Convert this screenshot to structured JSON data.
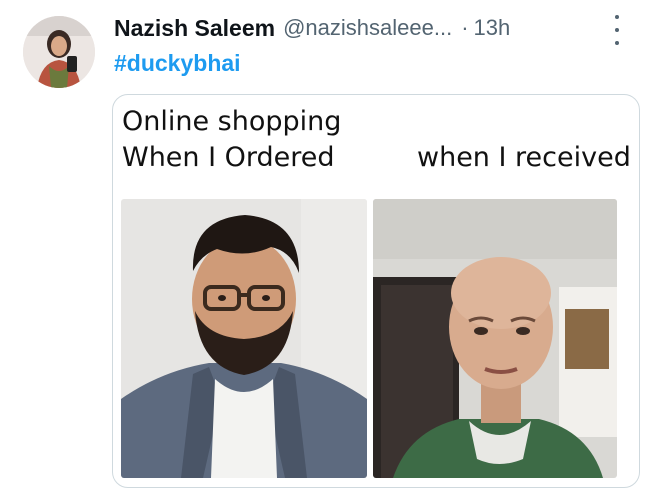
{
  "tweet": {
    "author": {
      "name": "Nazish Saleem",
      "handle": "@nazishsaleee...",
      "avatar_icon": "profile-photo"
    },
    "separator": "·",
    "time": "13h",
    "hashtag": "#duckybhai",
    "more_icon": "vertical-ellipsis-icon"
  },
  "meme": {
    "line1": "Online shopping",
    "left_caption": "When I Ordered",
    "right_caption": "when I received",
    "left_image": "man-with-glasses-and-beard",
    "right_image": "bald-man-in-green-shirt"
  },
  "colors": {
    "text_primary": "#0f1419",
    "text_secondary": "#536471",
    "hashtag": "#1d9bf0",
    "card_border": "#cfd9de"
  }
}
